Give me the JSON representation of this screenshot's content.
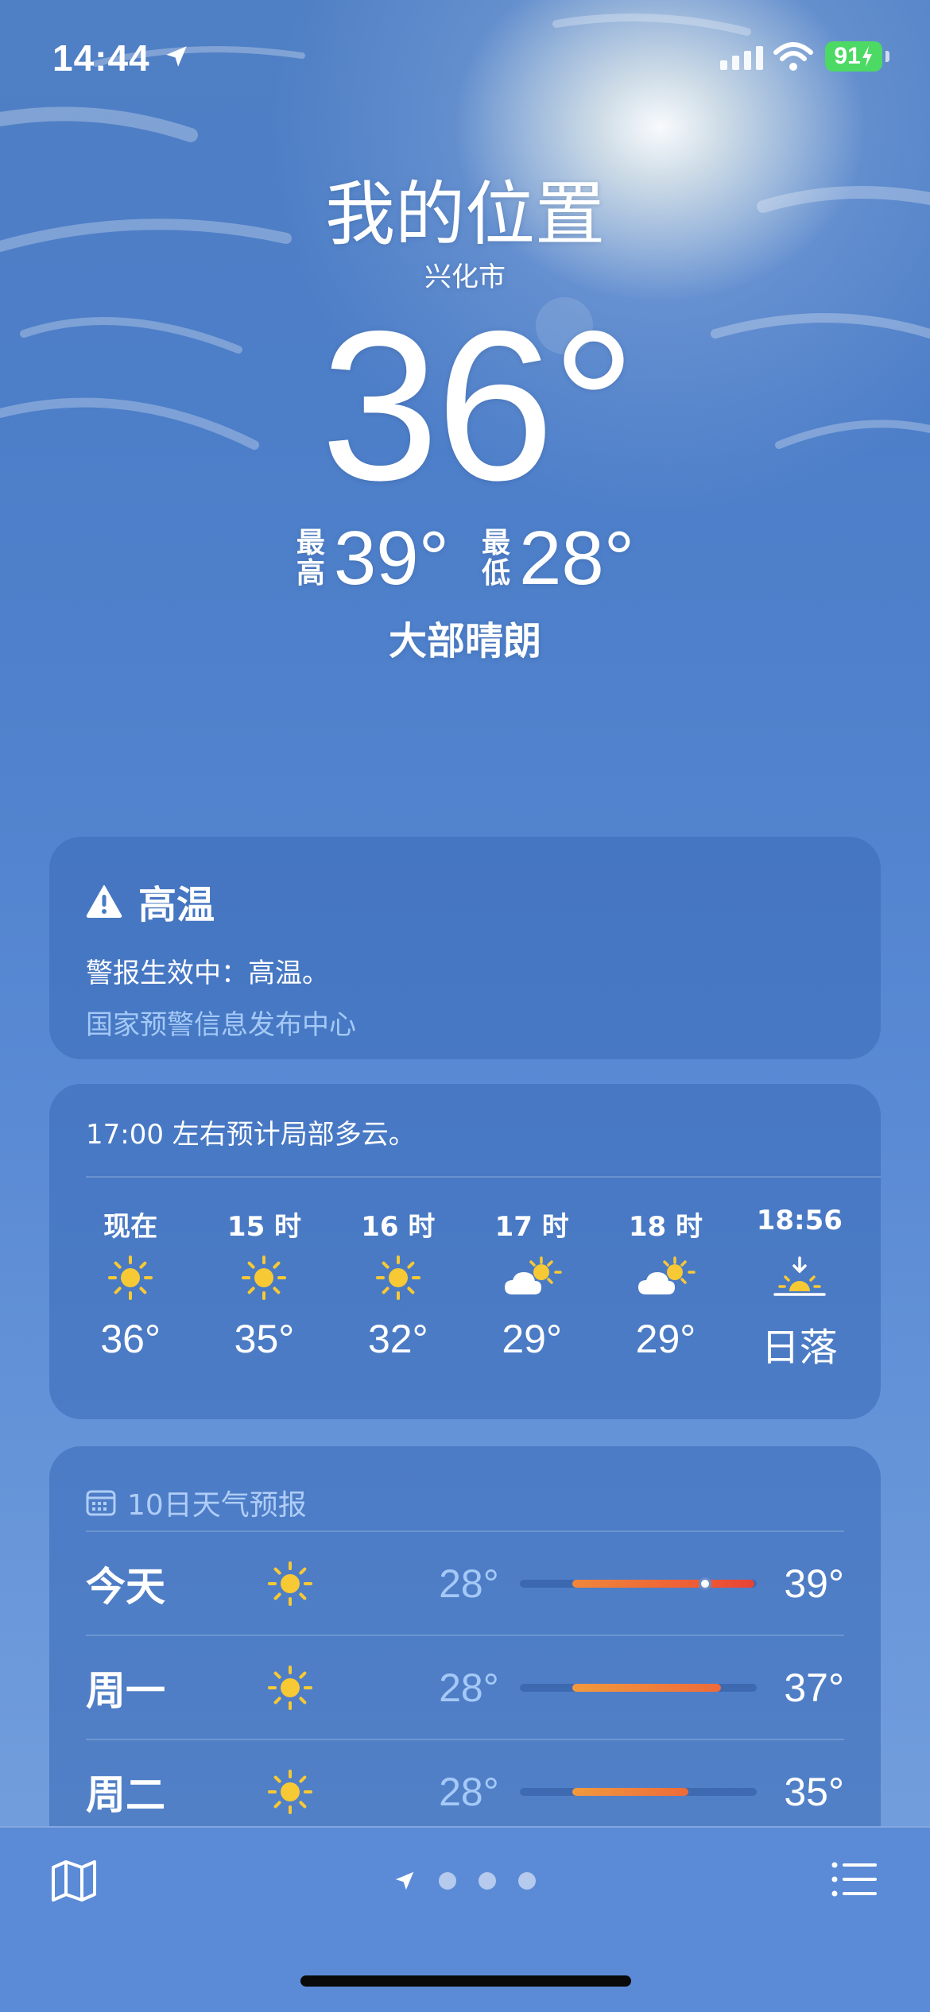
{
  "status_bar": {
    "time": "14:44",
    "battery": "91"
  },
  "header": {
    "title": "我的位置",
    "city": "兴化市",
    "current_temp": "36°",
    "high_label": "最高",
    "high": "39°",
    "low_label": "最低",
    "low": "28°",
    "condition": "大部晴朗"
  },
  "alert": {
    "title": "高温",
    "text": "警报生效中：高温。",
    "source": "国家预警信息发布中心"
  },
  "hourly": {
    "summary": "17:00 左右预计局部多云。",
    "hours": [
      {
        "label": "现在",
        "icon": "sun-icon",
        "temp": "36°"
      },
      {
        "label": "15 时",
        "icon": "sun-icon",
        "temp": "35°"
      },
      {
        "label": "16 时",
        "icon": "sun-icon",
        "temp": "32°"
      },
      {
        "label": "17 时",
        "icon": "partly-cloudy-icon",
        "temp": "29°"
      },
      {
        "label": "18 时",
        "icon": "partly-cloudy-icon",
        "temp": "29°"
      },
      {
        "label": "18:56",
        "icon": "sunset-icon",
        "temp": "日落"
      }
    ]
  },
  "daily": {
    "header": "10日天气预报",
    "range_min": 28,
    "range_max": 39,
    "days": [
      {
        "name": "今天",
        "icon": "sun-icon",
        "low": "28°",
        "high": "39°",
        "low_value": 28,
        "high_value": 39,
        "current_value": 36
      },
      {
        "name": "周一",
        "icon": "sun-icon",
        "low": "28°",
        "high": "37°",
        "low_value": 28,
        "high_value": 37
      },
      {
        "name": "周二",
        "icon": "sun-icon",
        "low": "28°",
        "high": "35°",
        "low_value": 28,
        "high_value": 35
      }
    ]
  },
  "colors": {
    "sun": "#f7c934",
    "bar_warm": "#f19a3e",
    "bar_hot": "#e84235",
    "battery": "#4cd964"
  }
}
